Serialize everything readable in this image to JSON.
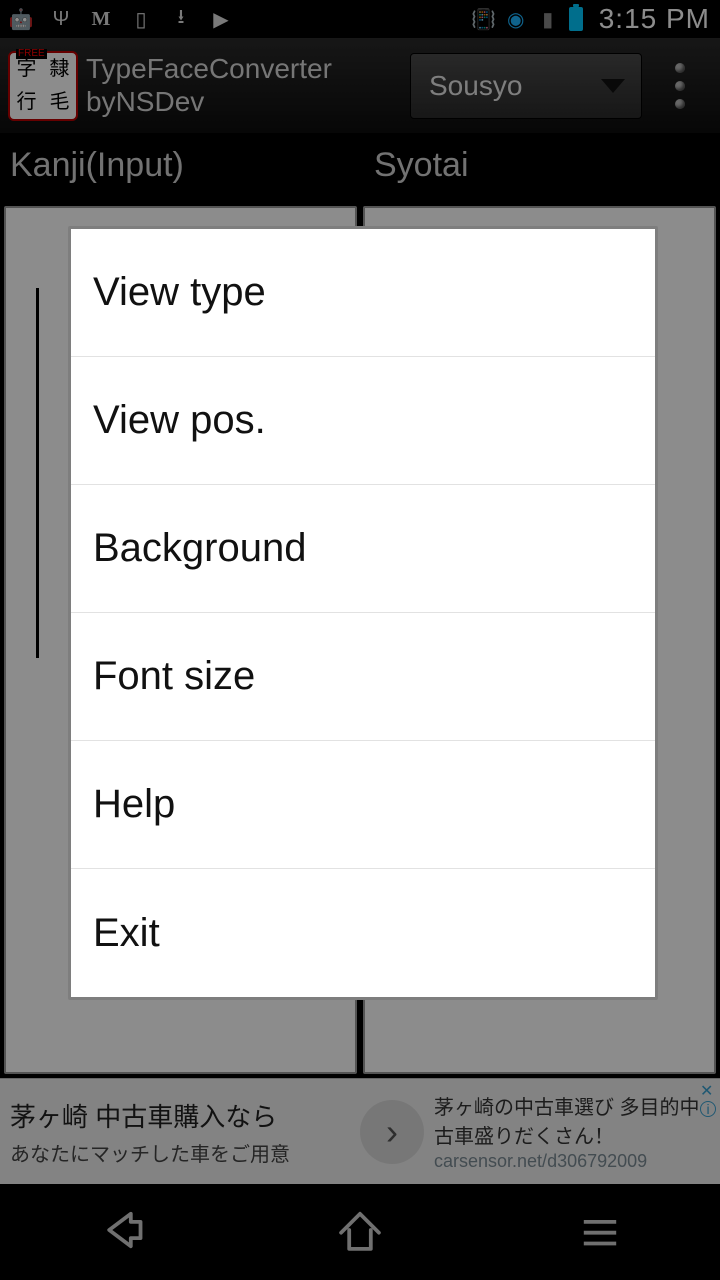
{
  "status": {
    "time": "3:15 PM"
  },
  "header": {
    "title_line1": "TypeFaceConverter",
    "title_line2": "byNSDev",
    "spinner_value": "Sousyo"
  },
  "labels": {
    "left": "Kanji(Input)",
    "right": "Syotai"
  },
  "menu": {
    "items": [
      {
        "label": "View type"
      },
      {
        "label": "View pos."
      },
      {
        "label": "Background"
      },
      {
        "label": "Font size"
      },
      {
        "label": "Help"
      },
      {
        "label": "Exit"
      }
    ]
  },
  "ad": {
    "title": "茅ヶ崎 中古車購入なら",
    "subtitle": "あなたにマッチした車をご用意",
    "right1": "茅ヶ崎の中古車選び 多目的中古車盛りだくさん！",
    "right2": "carsensor.net/d306792009"
  }
}
